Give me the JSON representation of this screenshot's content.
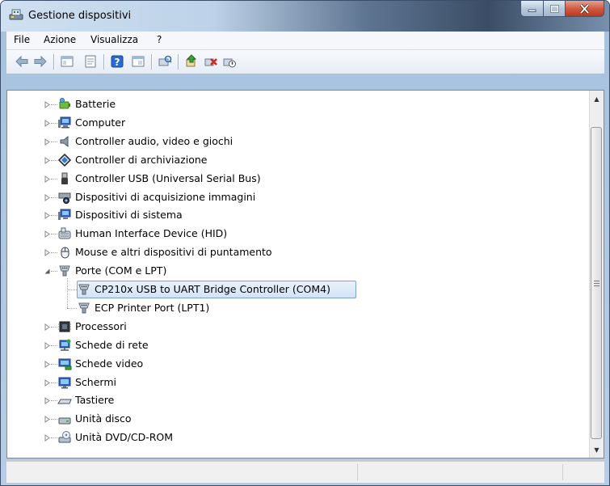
{
  "window": {
    "title": "Gestione dispositivi",
    "icon": "device-manager-icon"
  },
  "menu": [
    {
      "label": "File"
    },
    {
      "label": "Azione"
    },
    {
      "label": "Visualizza"
    },
    {
      "label": "?"
    }
  ],
  "toolbar": [
    {
      "icon": "back-arrow-icon"
    },
    {
      "icon": "forward-arrow-icon"
    },
    {
      "icon": "show-hide-tree-icon"
    },
    {
      "icon": "properties-icon"
    },
    {
      "icon": "help-icon"
    },
    {
      "icon": "list-view-icon"
    },
    {
      "icon": "scan-hardware-icon"
    },
    {
      "icon": "update-driver-icon"
    },
    {
      "icon": "uninstall-device-icon"
    },
    {
      "icon": "disable-device-icon"
    }
  ],
  "tree": {
    "items": [
      {
        "label": "Batterie",
        "icon": "battery-icon",
        "expanded": false
      },
      {
        "label": "Computer",
        "icon": "computer-icon",
        "expanded": false
      },
      {
        "label": "Controller audio, video e giochi",
        "icon": "speaker-icon",
        "expanded": false
      },
      {
        "label": "Controller di archiviazione",
        "icon": "storage-controller-icon",
        "expanded": false
      },
      {
        "label": "Controller USB (Universal Serial Bus)",
        "icon": "usb-icon",
        "expanded": false
      },
      {
        "label": "Dispositivi di acquisizione immagini",
        "icon": "scanner-camera-icon",
        "expanded": false
      },
      {
        "label": "Dispositivi di sistema",
        "icon": "system-device-icon",
        "expanded": false
      },
      {
        "label": "Human Interface Device (HID)",
        "icon": "hid-icon",
        "expanded": false
      },
      {
        "label": "Mouse e altri dispositivi di puntamento",
        "icon": "mouse-icon",
        "expanded": false
      },
      {
        "label": "Porte (COM e LPT)",
        "icon": "port-icon",
        "expanded": true,
        "children": [
          {
            "label": "CP210x USB to UART Bridge Controller (COM4)",
            "icon": "port-icon",
            "selected": true
          },
          {
            "label": "ECP Printer Port (LPT1)",
            "icon": "port-icon",
            "selected": false
          }
        ]
      },
      {
        "label": "Processori",
        "icon": "processor-icon",
        "expanded": false
      },
      {
        "label": "Schede di rete",
        "icon": "network-adapter-icon",
        "expanded": false
      },
      {
        "label": "Schede video",
        "icon": "display-adapter-icon",
        "expanded": false
      },
      {
        "label": "Schermi",
        "icon": "monitor-icon",
        "expanded": false
      },
      {
        "label": "Tastiere",
        "icon": "keyboard-icon",
        "expanded": false
      },
      {
        "label": "Unità disco",
        "icon": "disk-drive-icon",
        "expanded": false
      },
      {
        "label": "Unità DVD/CD-ROM",
        "icon": "dvd-drive-icon",
        "expanded": false
      }
    ]
  },
  "colors": {
    "selection_border": "#7da2ce",
    "selection_fill": "#d3e3f6",
    "close_button": "#c7432a"
  }
}
